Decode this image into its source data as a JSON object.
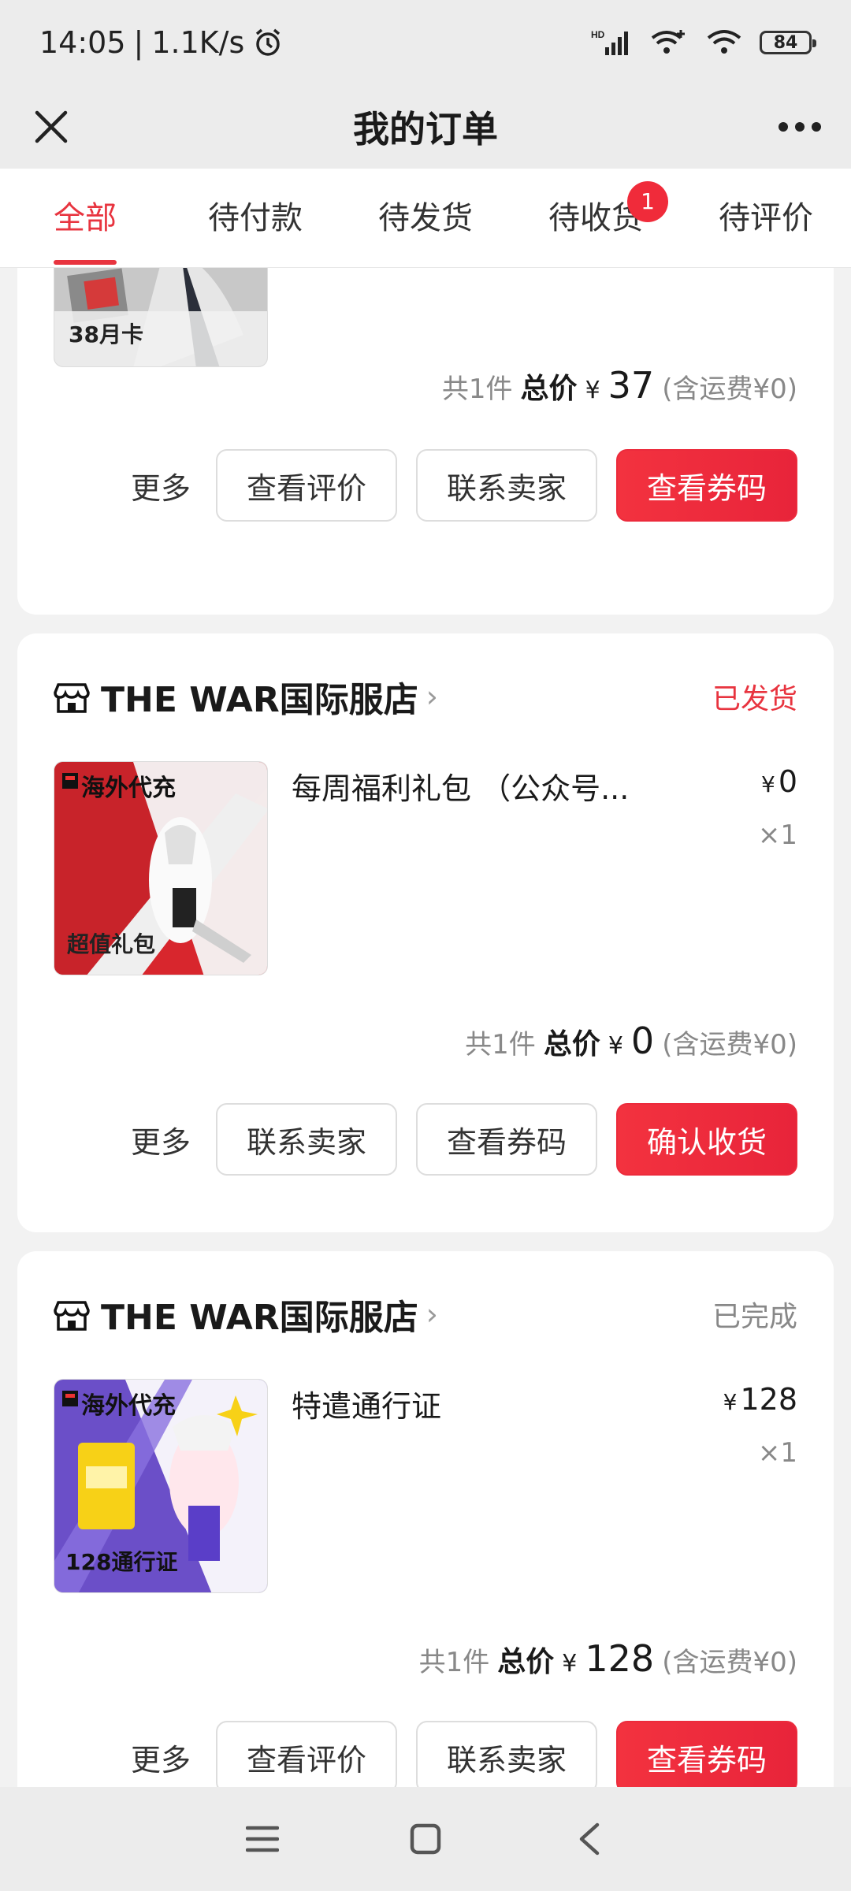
{
  "status_bar": {
    "time": "14:05",
    "net_speed": "1.1K/s",
    "battery": "84"
  },
  "nav": {
    "title": "我的订单"
  },
  "tabs": [
    {
      "label": "全部"
    },
    {
      "label": "待付款"
    },
    {
      "label": "待发货"
    },
    {
      "label": "待收货",
      "badge": "1"
    },
    {
      "label": "待评价"
    }
  ],
  "colors": {
    "accent": "#e8343f",
    "primary_button": "#ec2b3c",
    "shipped": "#e8343f",
    "completed": "#888888"
  },
  "orders": [
    {
      "thumb_text": "38月卡",
      "total_count": "共1件",
      "total_label": "总价",
      "total_yen": "¥",
      "total_amount": "37",
      "shipping": "(含运费¥0)",
      "more": "更多",
      "buttons": [
        "查看评价",
        "联系卖家",
        "查看券码"
      ]
    },
    {
      "shop": "THE WAR国际服店",
      "status": "已发货",
      "thumb_top": "海外代充",
      "thumb_text": "超值礼包",
      "product_name": "每周福利礼包 （公众号...",
      "price_yen": "¥",
      "price": "0",
      "qty": "×1",
      "total_count": "共1件",
      "total_label": "总价",
      "total_yen": "¥",
      "total_amount": "0",
      "shipping": "(含运费¥0)",
      "more": "更多",
      "buttons": [
        "联系卖家",
        "查看券码",
        "确认收货"
      ]
    },
    {
      "shop": "THE WAR国际服店",
      "status": "已完成",
      "thumb_top": "海外代充",
      "thumb_text": "128通行证",
      "product_name": "特遣通行证",
      "price_yen": "¥",
      "price": "128",
      "qty": "×1",
      "total_count": "共1件",
      "total_label": "总价",
      "total_yen": "¥",
      "total_amount": "128",
      "shipping": "(含运费¥0)",
      "more": "更多",
      "buttons": [
        "查看评价",
        "联系卖家",
        "查看券码"
      ]
    }
  ]
}
